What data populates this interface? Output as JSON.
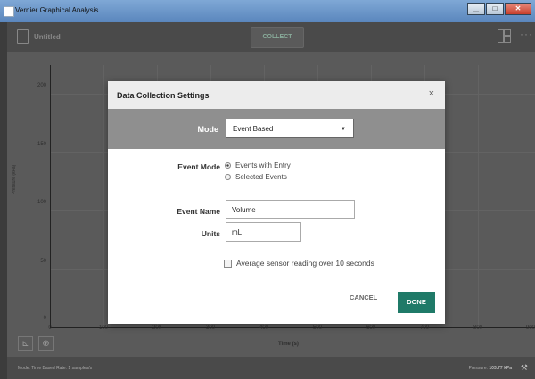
{
  "window": {
    "title": "Vernier Graphical Analysis",
    "minimize": "▁",
    "maximize": "□",
    "close": "✕"
  },
  "toolbar": {
    "document_title": "Untitled",
    "collect_label": "COLLECT",
    "more_label": "···"
  },
  "graph": {
    "y_axis_label": "Pressure (kPa)",
    "x_axis_label": "Time (s)",
    "y_ticks": [
      "200",
      "150",
      "100",
      "50",
      "0"
    ],
    "x_ticks": [
      "0",
      "100",
      "200",
      "300",
      "400",
      "500",
      "600",
      "700",
      "800",
      "900"
    ]
  },
  "statusbar": {
    "left_text": "Mode: Time Based   Rate: 1 samples/s",
    "right_label": "Pressure:",
    "right_value": "103.77 kPa"
  },
  "dialog": {
    "title": "Data Collection Settings",
    "close_label": "×",
    "mode_label": "Mode",
    "mode_value": "Event Based",
    "event_mode_label": "Event Mode",
    "event_mode_options": [
      "Events with Entry",
      "Selected Events"
    ],
    "event_name_label": "Event Name",
    "event_name_value": "Volume",
    "units_label": "Units",
    "units_value": "mL",
    "average_checkbox_label": "Average sensor reading over 10 seconds",
    "cancel_label": "CANCEL",
    "done_label": "DONE"
  },
  "colors": {
    "accent": "#1f7a68",
    "mode_bar": "#8f8f8f"
  }
}
